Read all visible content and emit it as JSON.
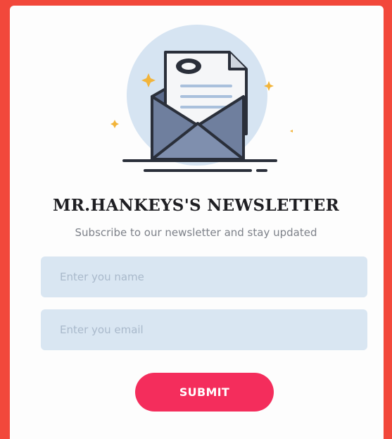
{
  "newsletter": {
    "title": "MR.HANKEYS'S NEWSLETTER",
    "subtitle": "Subscribe to our newsletter and stay updated",
    "name_placeholder": "Enter you name",
    "email_placeholder": "Enter you email",
    "submit_label": "SUBMIT"
  },
  "colors": {
    "background": "#f2483b",
    "card": "#fdfdfd",
    "field_bg": "#d9e6f2",
    "button": "#f42d5c",
    "circle": "#d6e4f2",
    "envelope": "#6f7f9e",
    "sparkle": "#f2b43a"
  },
  "icons": [
    "envelope-letter-icon",
    "sparkle-icon"
  ]
}
